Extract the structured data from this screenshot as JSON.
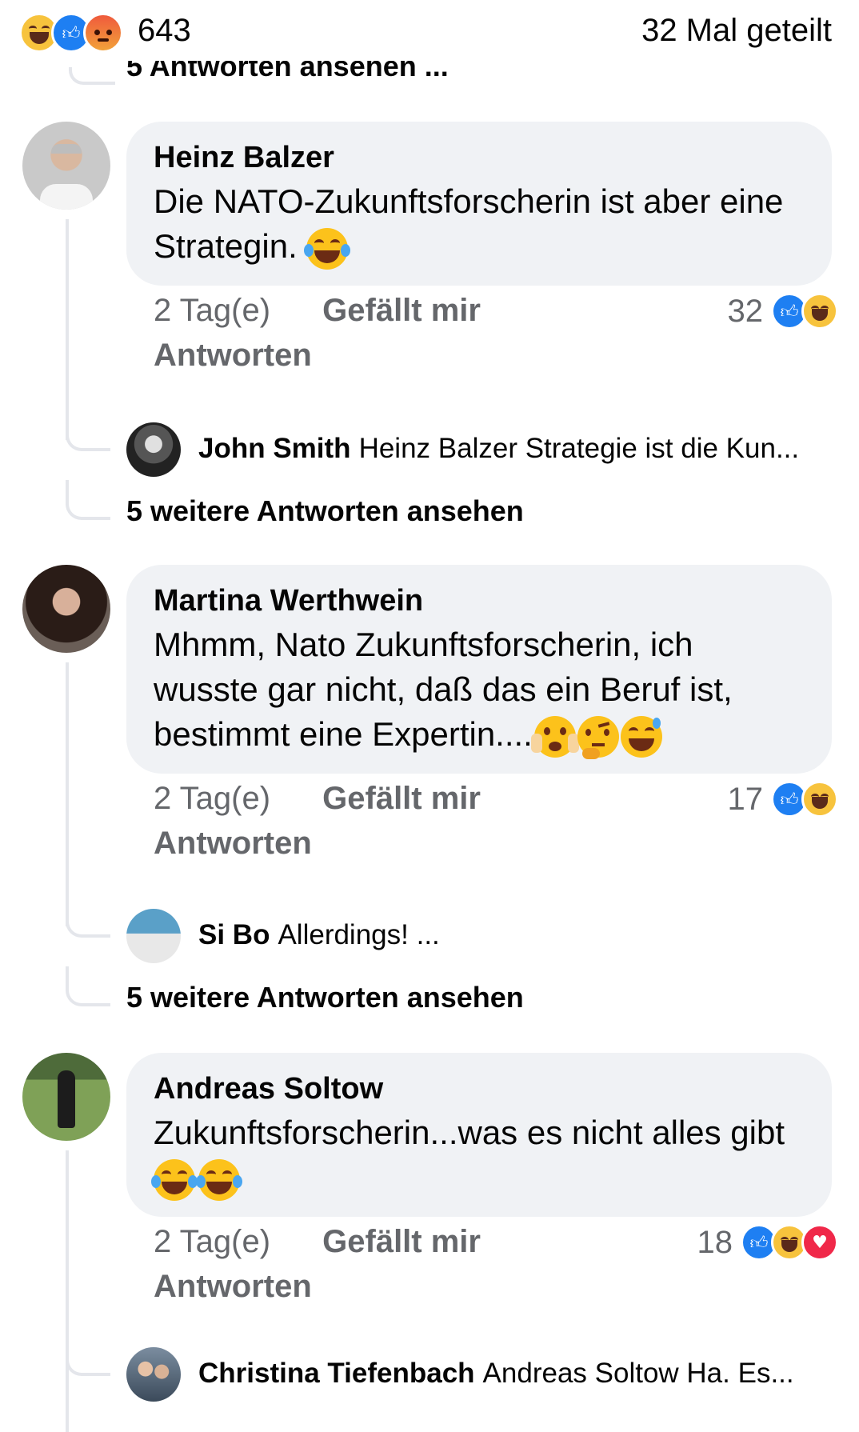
{
  "header": {
    "reaction_icons": [
      "haha-icon",
      "like-icon",
      "angry-icon"
    ],
    "reaction_count": "643",
    "shares": "32 Mal geteilt"
  },
  "previous": {
    "cut_text": "5 Antworten ansehen ..."
  },
  "comments": [
    {
      "author": "Heinz Balzer",
      "text": "Die NATO-Zukunftsforscherin ist aber eine Strategin.",
      "emojis": [
        "tears-of-joy-emoji"
      ],
      "time": "2 Tag(e)",
      "like_label": "Gefällt mir",
      "reply_label": "Antworten",
      "reaction_count": "32",
      "reactions": [
        "like-icon",
        "haha-icon"
      ],
      "reply": {
        "author": "John Smith",
        "text": "Heinz Balzer Strategie ist die Kun..."
      },
      "more_replies": "5 weitere Antworten ansehen"
    },
    {
      "author": "Martina Werthwein",
      "text": "Mhmm,  Nato Zukunftsforscherin, ich wusste gar nicht,  daß das ein Beruf ist, bestimmt eine Expertin....",
      "emojis": [
        "scared-face-emoji",
        "thinking-face-emoji",
        "sweat-smile-emoji"
      ],
      "time": "2 Tag(e)",
      "like_label": "Gefällt mir",
      "reply_label": "Antworten",
      "reaction_count": "17",
      "reactions": [
        "like-icon",
        "haha-icon"
      ],
      "reply": {
        "author": "Si Bo",
        "text": "Allerdings! ..."
      },
      "more_replies": "5 weitere Antworten ansehen"
    },
    {
      "author": "Andreas Soltow",
      "text": "Zukunftsforscherin...was es nicht alles gibt",
      "emojis": [
        "tears-of-joy-emoji",
        "tears-of-joy-emoji"
      ],
      "time": "2 Tag(e)",
      "like_label": "Gefällt mir",
      "reply_label": "Antworten",
      "reaction_count": "18",
      "reactions": [
        "like-icon",
        "haha-icon",
        "love-icon"
      ],
      "reply": {
        "author": "Christina Tiefenbach",
        "text": "Andreas Soltow Ha. Es..."
      }
    }
  ],
  "colors": {
    "bubble": "#f0f2f5",
    "meta": "#65676b",
    "like_blue": "#1e7ff2",
    "haha_yellow": "#f7c33d",
    "love_red": "#f02849",
    "thread_line": "#e4e6eb"
  }
}
